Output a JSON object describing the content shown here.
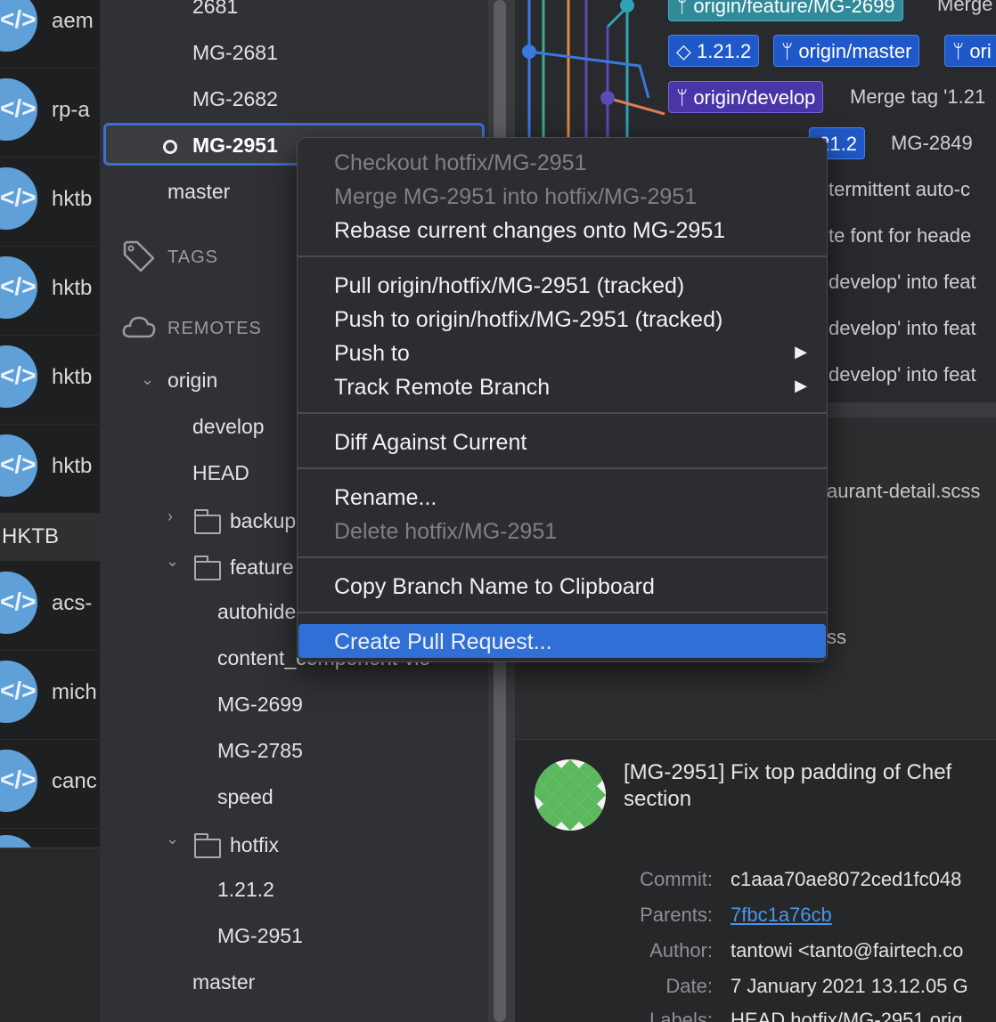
{
  "repos": {
    "items": [
      {
        "name": "aem"
      },
      {
        "name": "rp-a"
      },
      {
        "name": "hktb"
      },
      {
        "name": "hktb"
      },
      {
        "name": "hktb"
      },
      {
        "name": "hktb"
      }
    ],
    "group_label": "HKTB",
    "group_items": [
      {
        "name": "acs-"
      },
      {
        "name": "mich"
      },
      {
        "name": "canc"
      }
    ],
    "avatar_glyph": "</>"
  },
  "sidebar": {
    "branches": [
      "2681",
      "MG-2681",
      "MG-2682",
      "MG-2951",
      "master"
    ],
    "tags_header": "TAGS",
    "remotes_header": "REMOTES",
    "remote_origin": "origin",
    "origin_items": [
      "develop",
      "HEAD"
    ],
    "folder_backup": "backup",
    "folder_feature": "feature",
    "feature_items": [
      "autohide",
      "content_component-vie",
      "MG-2699",
      "MG-2785",
      "speed"
    ],
    "folder_hotfix": "hotfix",
    "hotfix_items": [
      "1.21.2",
      "MG-2951"
    ],
    "bottom_master": "master"
  },
  "graph": {
    "labels": {
      "feature_2699": "origin/feature/MG-2699",
      "tag_1212": "1.21.2",
      "origin_master": "origin/master",
      "origin_partial": "ori",
      "origin_develop": "origin/develop",
      "hotfix_partial": ".21.2"
    },
    "messages": [
      "Merge",
      "Merge tag '1.21",
      "MG-2849",
      "termittent auto-c",
      "te font for heade",
      "develop' into feat",
      "develop' into feat",
      "develop' into feat"
    ],
    "colors": {
      "blue": "#3b78e0",
      "cyan": "#2fa3b8",
      "orange": "#e08a3c",
      "purple": "#5b4bb4",
      "red_orange": "#e07a50",
      "teal": "#3ea896"
    }
  },
  "filepane": {
    "file1": "aurant-detail.scss",
    "file2": "ss"
  },
  "commit": {
    "title": "[MG-2951] Fix top padding of Chef section",
    "title_line1": "[MG-2951] Fix top padding of Chef",
    "title_line2": "section",
    "commit_label": "Commit:",
    "commit_value": "c1aaa70ae8072ced1fc048",
    "parents_label": "Parents:",
    "parents_value": "7fbc1a76cb",
    "author_label": "Author:",
    "author_value": "tantowi <tanto@fairtech.co",
    "date_label": "Date:",
    "date_value": "7 January 2021 13.12.05 G",
    "labels_label": "Labels:",
    "labels_value": "HEAD hotfix/MG-2951 orig"
  },
  "context_menu": {
    "items": [
      {
        "label": "Checkout hotfix/MG-2951",
        "disabled": true
      },
      {
        "label": "Merge MG-2951 into hotfix/MG-2951",
        "disabled": true
      },
      {
        "label": "Rebase current changes onto MG-2951",
        "disabled": false
      },
      {
        "label": "Pull origin/hotfix/MG-2951 (tracked)",
        "disabled": false
      },
      {
        "label": "Push to origin/hotfix/MG-2951 (tracked)",
        "disabled": false
      },
      {
        "label": "Push to",
        "disabled": false,
        "submenu": true
      },
      {
        "label": "Track Remote Branch",
        "disabled": false,
        "submenu": true
      },
      {
        "label": "Diff Against Current",
        "disabled": false
      },
      {
        "label": "Rename...",
        "disabled": false
      },
      {
        "label": "Delete hotfix/MG-2951",
        "disabled": true
      },
      {
        "label": "Copy Branch Name to Clipboard",
        "disabled": false
      },
      {
        "label": "Create Pull Request...",
        "disabled": false,
        "highlighted": true
      }
    ],
    "submenu_arrow": "▶"
  }
}
